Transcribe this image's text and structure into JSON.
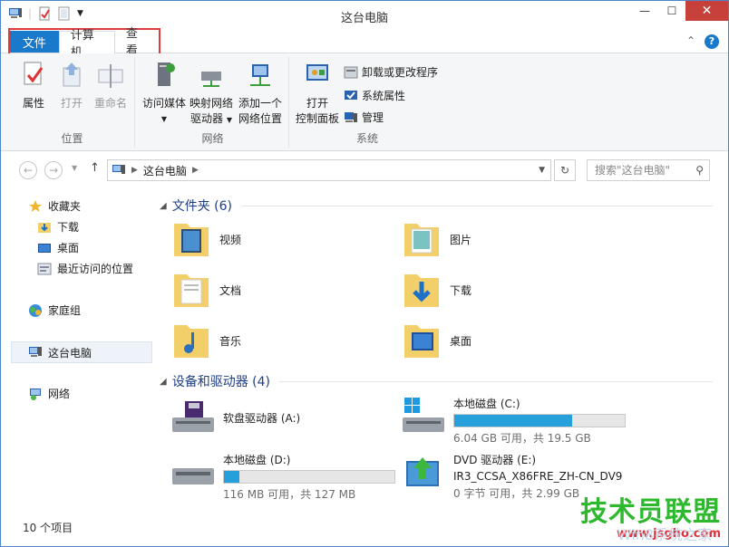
{
  "window": {
    "title": "这台电脑"
  },
  "tabs": [
    {
      "label": "文件"
    },
    {
      "label": "计算机"
    },
    {
      "label": "查看"
    }
  ],
  "ribbon": {
    "groups": [
      {
        "name": "位置",
        "buttons": [
          "属性",
          "打开",
          "重命名"
        ]
      },
      {
        "name": "网络",
        "buttons": [
          "访问媒体",
          "映射网络",
          "驱动器",
          "添加一个",
          "网络位置"
        ]
      },
      {
        "name": "系统",
        "buttons": [
          "打开",
          "控制面板"
        ],
        "small": [
          "卸载或更改程序",
          "系统属性",
          "管理"
        ]
      }
    ]
  },
  "address": {
    "path": "这台电脑",
    "search_placeholder": "搜索\"这台电脑\""
  },
  "nav": {
    "favorites": "收藏夹",
    "downloads": "下载",
    "desktop": "桌面",
    "recent": "最近访问的位置",
    "homegroup": "家庭组",
    "thispc": "这台电脑",
    "network": "网络"
  },
  "folders_section": "文件夹 (6)",
  "folders": [
    "视频",
    "图片",
    "文档",
    "下载",
    "音乐",
    "桌面"
  ],
  "drives_section": "设备和驱动器 (4)",
  "drives": [
    {
      "name": "软盘驱动器 (A:)"
    },
    {
      "name": "本地磁盘 (C:)",
      "usage": "6.04 GB 可用，共 19.5 GB",
      "fill": 0.69
    },
    {
      "name": "本地磁盘 (D:)",
      "usage": "116 MB 可用，共 127 MB",
      "fill": 0.09
    },
    {
      "name": "DVD 驱动器 (E:)",
      "label": "IR3_CCSA_X86FRE_ZH-CN_DV9",
      "usage": "0 字节 可用，共 2.99 GB"
    }
  ],
  "status": {
    "count": "10 个项目"
  },
  "watermark": {
    "brand": "技术员联盟",
    "url": "www.jsgho.com",
    "sub": "Win8系统之家"
  },
  "colors": {
    "accent": "#1979ca",
    "close": "#c7403a",
    "highlight_box": "#e23a3a"
  }
}
